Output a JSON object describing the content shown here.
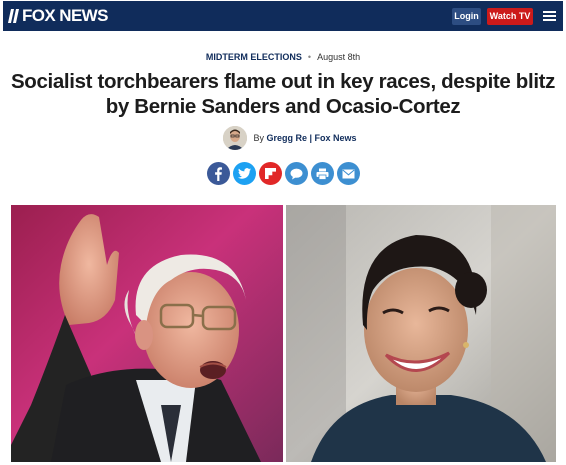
{
  "header": {
    "logo_text": "FOX NEWS",
    "login_label": "Login",
    "watch_label": "Watch TV",
    "menu_icon": "hamburger-menu-icon",
    "colors": {
      "bar": "#102c5b",
      "login_bg": "#2d4d82",
      "watch_bg": "#cc1a1a"
    }
  },
  "article": {
    "category": "MIDTERM ELECTIONS",
    "separator": "•",
    "date": "August 8th",
    "headline": "Socialist torchbearers flame out in key races, despite blitz by Bernie Sanders and Ocasio-Cortez",
    "byline": {
      "prefix": "By",
      "author": "Gregg Re | Fox News"
    }
  },
  "share": [
    {
      "name": "facebook-share-icon",
      "color": "#3b5998"
    },
    {
      "name": "twitter-share-icon",
      "color": "#1da1f2"
    },
    {
      "name": "flipboard-share-icon",
      "color": "#e12828"
    },
    {
      "name": "comment-share-icon",
      "color": "#3d8fd1"
    },
    {
      "name": "print-share-icon",
      "color": "#3d8fd1"
    },
    {
      "name": "email-share-icon",
      "color": "#3d8fd1"
    }
  ],
  "hero": {
    "left_subject": "man-speaking-photo",
    "right_subject": "woman-smiling-photo"
  }
}
